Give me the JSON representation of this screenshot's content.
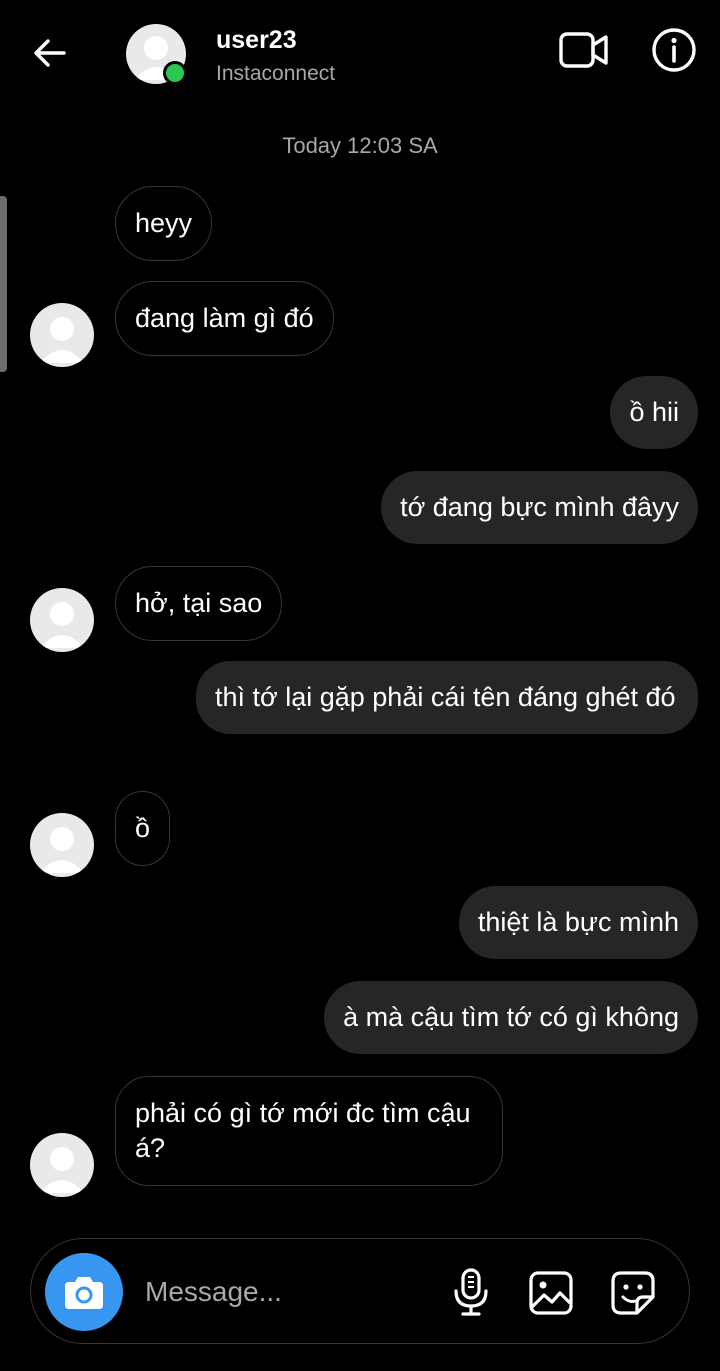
{
  "header": {
    "username": "user23",
    "subtitle": "Instaconnect",
    "online_color": "#2dc653",
    "icons": [
      "back-arrow-icon",
      "video-call-icon",
      "info-icon"
    ]
  },
  "timestamp": "Today 12:03 SA",
  "messages": [
    {
      "side": "received",
      "text": "heyy"
    },
    {
      "side": "received",
      "text": "đang làm gì đó"
    },
    {
      "side": "sent",
      "text": "ồ hii"
    },
    {
      "side": "sent",
      "text": "tớ đang bực mình đâyy"
    },
    {
      "side": "received",
      "text": "hở, tại sao"
    },
    {
      "side": "sent",
      "text": "thì tớ lại gặp phải cái tên đáng ghét đó"
    },
    {
      "side": "received",
      "text": "ồ"
    },
    {
      "side": "sent",
      "text": "thiệt là bực mình"
    },
    {
      "side": "sent",
      "text": "à mà cậu tìm tớ có gì không"
    },
    {
      "side": "received",
      "text": "phải có gì tớ mới đc tìm cậu á?"
    }
  ],
  "composer": {
    "placeholder": "Message...",
    "camera_color": "#3797f0",
    "icons": [
      "camera-icon",
      "microphone-icon",
      "gallery-icon",
      "sticker-icon"
    ]
  }
}
